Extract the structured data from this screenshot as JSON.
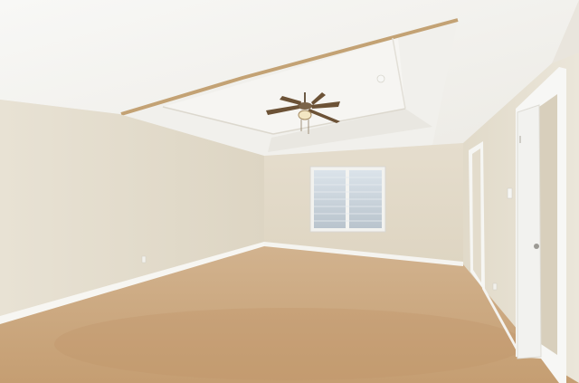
{
  "scene": {
    "subject": "empty-bedroom-interior",
    "elements": [
      "ceiling",
      "tray-ceiling",
      "ceiling-fan",
      "left-wall",
      "back-wall",
      "right-wall",
      "window",
      "doorway",
      "open-door",
      "carpet-floor",
      "baseboards",
      "light-switch"
    ]
  },
  "colors": {
    "ceiling": "#f4f3ef",
    "tray_trim": "#c7a57a",
    "wall_light": "#e7e1d3",
    "wall_shadow": "#d8d0bd",
    "carpet": "#caa57c",
    "carpet_dark": "#b89069",
    "baseboard": "#f7f7f4",
    "door_trim": "#f3f3f0",
    "window_glass": "#c6d2dc"
  }
}
